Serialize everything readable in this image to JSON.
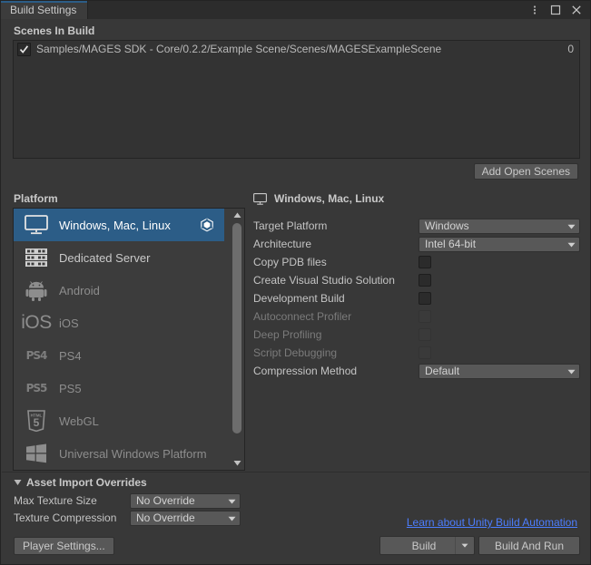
{
  "window": {
    "tab_label": "Build Settings",
    "controls": [
      {
        "name": "more-options-icon",
        "glyph": "kebab"
      },
      {
        "name": "maximize-icon",
        "glyph": "square"
      },
      {
        "name": "close-icon",
        "glyph": "x"
      }
    ]
  },
  "scenes": {
    "header": "Scenes In Build",
    "rows": [
      {
        "checked": true,
        "path": "Samples/MAGES SDK - Core/0.2.2/Example Scene/Scenes/MAGESExampleScene",
        "index": "0"
      }
    ],
    "add_open_scenes_label": "Add Open Scenes"
  },
  "platform": {
    "header": "Platform",
    "items": [
      {
        "label": "Windows, Mac, Linux",
        "icon": "monitor-icon",
        "selected": true,
        "enabled": true,
        "badge": "unity-logo-icon"
      },
      {
        "label": "Dedicated Server",
        "icon": "server-icon",
        "selected": false,
        "enabled": true,
        "badge": ""
      },
      {
        "label": "Android",
        "icon": "android-icon",
        "selected": false,
        "enabled": false,
        "badge": ""
      },
      {
        "label": "iOS",
        "icon": "ios-icon",
        "selected": false,
        "enabled": false,
        "badge": ""
      },
      {
        "label": "PS4",
        "icon": "ps4-icon",
        "selected": false,
        "enabled": false,
        "badge": ""
      },
      {
        "label": "PS5",
        "icon": "ps5-icon",
        "selected": false,
        "enabled": false,
        "badge": ""
      },
      {
        "label": "WebGL",
        "icon": "html5-icon",
        "selected": false,
        "enabled": false,
        "badge": ""
      },
      {
        "label": "Universal Windows Platform",
        "icon": "windows-icon",
        "selected": false,
        "enabled": false,
        "badge": ""
      }
    ]
  },
  "settings": {
    "header": "Windows, Mac, Linux",
    "rows": [
      {
        "label": "Target Platform",
        "type": "dropdown",
        "value": "Windows",
        "disabled": false
      },
      {
        "label": "Architecture",
        "type": "dropdown",
        "value": "Intel 64-bit",
        "disabled": false
      },
      {
        "label": "Copy PDB files",
        "type": "checkbox",
        "checked": false,
        "disabled": false
      },
      {
        "label": "Create Visual Studio Solution",
        "type": "checkbox",
        "checked": false,
        "disabled": false
      },
      {
        "label": "Development Build",
        "type": "checkbox",
        "checked": false,
        "disabled": false
      },
      {
        "label": "Autoconnect Profiler",
        "type": "checkbox",
        "checked": false,
        "disabled": true
      },
      {
        "label": "Deep Profiling",
        "type": "checkbox",
        "checked": false,
        "disabled": true
      },
      {
        "label": "Script Debugging",
        "type": "checkbox",
        "checked": false,
        "disabled": true
      },
      {
        "label": "Compression Method",
        "type": "dropdown",
        "value": "Default",
        "disabled": false
      }
    ]
  },
  "asset_import_overrides": {
    "header": "Asset Import Overrides",
    "rows": [
      {
        "label": "Max Texture Size",
        "value": "No Override"
      },
      {
        "label": "Texture Compression",
        "value": "No Override"
      }
    ]
  },
  "footer": {
    "player_settings_label": "Player Settings...",
    "automation_link": "Learn about Unity Build Automation",
    "build_label": "Build",
    "build_and_run_label": "Build And Run"
  },
  "colors": {
    "accent_selected": "#2c5d87",
    "link": "#4c7eff",
    "window_bg": "#383838",
    "panel_bg": "#3c3c3c"
  }
}
